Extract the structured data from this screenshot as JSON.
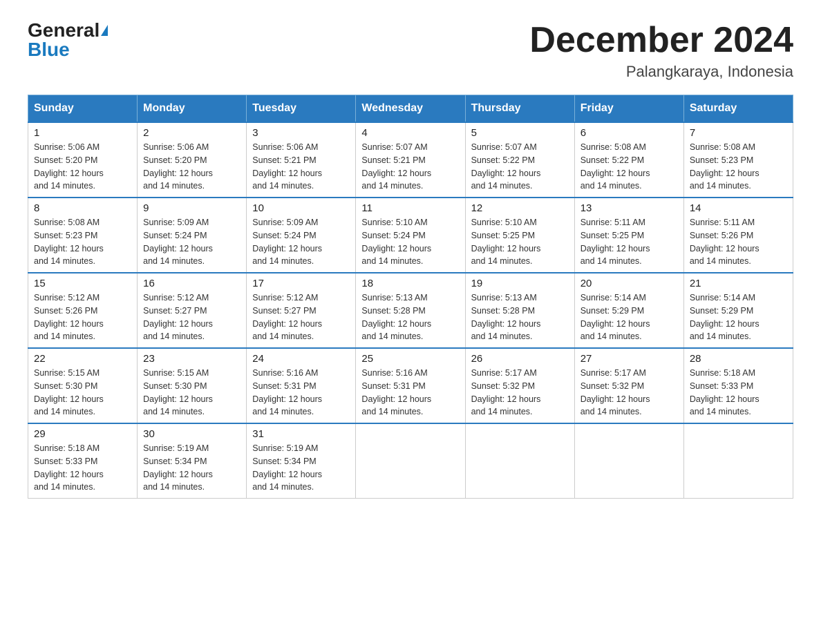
{
  "header": {
    "logo_general": "General",
    "logo_blue": "Blue",
    "month_title": "December 2024",
    "location": "Palangkaraya, Indonesia"
  },
  "days_of_week": [
    "Sunday",
    "Monday",
    "Tuesday",
    "Wednesday",
    "Thursday",
    "Friday",
    "Saturday"
  ],
  "weeks": [
    [
      {
        "day": "1",
        "sunrise": "5:06 AM",
        "sunset": "5:20 PM",
        "daylight": "12 hours and 14 minutes."
      },
      {
        "day": "2",
        "sunrise": "5:06 AM",
        "sunset": "5:20 PM",
        "daylight": "12 hours and 14 minutes."
      },
      {
        "day": "3",
        "sunrise": "5:06 AM",
        "sunset": "5:21 PM",
        "daylight": "12 hours and 14 minutes."
      },
      {
        "day": "4",
        "sunrise": "5:07 AM",
        "sunset": "5:21 PM",
        "daylight": "12 hours and 14 minutes."
      },
      {
        "day": "5",
        "sunrise": "5:07 AM",
        "sunset": "5:22 PM",
        "daylight": "12 hours and 14 minutes."
      },
      {
        "day": "6",
        "sunrise": "5:08 AM",
        "sunset": "5:22 PM",
        "daylight": "12 hours and 14 minutes."
      },
      {
        "day": "7",
        "sunrise": "5:08 AM",
        "sunset": "5:23 PM",
        "daylight": "12 hours and 14 minutes."
      }
    ],
    [
      {
        "day": "8",
        "sunrise": "5:08 AM",
        "sunset": "5:23 PM",
        "daylight": "12 hours and 14 minutes."
      },
      {
        "day": "9",
        "sunrise": "5:09 AM",
        "sunset": "5:24 PM",
        "daylight": "12 hours and 14 minutes."
      },
      {
        "day": "10",
        "sunrise": "5:09 AM",
        "sunset": "5:24 PM",
        "daylight": "12 hours and 14 minutes."
      },
      {
        "day": "11",
        "sunrise": "5:10 AM",
        "sunset": "5:24 PM",
        "daylight": "12 hours and 14 minutes."
      },
      {
        "day": "12",
        "sunrise": "5:10 AM",
        "sunset": "5:25 PM",
        "daylight": "12 hours and 14 minutes."
      },
      {
        "day": "13",
        "sunrise": "5:11 AM",
        "sunset": "5:25 PM",
        "daylight": "12 hours and 14 minutes."
      },
      {
        "day": "14",
        "sunrise": "5:11 AM",
        "sunset": "5:26 PM",
        "daylight": "12 hours and 14 minutes."
      }
    ],
    [
      {
        "day": "15",
        "sunrise": "5:12 AM",
        "sunset": "5:26 PM",
        "daylight": "12 hours and 14 minutes."
      },
      {
        "day": "16",
        "sunrise": "5:12 AM",
        "sunset": "5:27 PM",
        "daylight": "12 hours and 14 minutes."
      },
      {
        "day": "17",
        "sunrise": "5:12 AM",
        "sunset": "5:27 PM",
        "daylight": "12 hours and 14 minutes."
      },
      {
        "day": "18",
        "sunrise": "5:13 AM",
        "sunset": "5:28 PM",
        "daylight": "12 hours and 14 minutes."
      },
      {
        "day": "19",
        "sunrise": "5:13 AM",
        "sunset": "5:28 PM",
        "daylight": "12 hours and 14 minutes."
      },
      {
        "day": "20",
        "sunrise": "5:14 AM",
        "sunset": "5:29 PM",
        "daylight": "12 hours and 14 minutes."
      },
      {
        "day": "21",
        "sunrise": "5:14 AM",
        "sunset": "5:29 PM",
        "daylight": "12 hours and 14 minutes."
      }
    ],
    [
      {
        "day": "22",
        "sunrise": "5:15 AM",
        "sunset": "5:30 PM",
        "daylight": "12 hours and 14 minutes."
      },
      {
        "day": "23",
        "sunrise": "5:15 AM",
        "sunset": "5:30 PM",
        "daylight": "12 hours and 14 minutes."
      },
      {
        "day": "24",
        "sunrise": "5:16 AM",
        "sunset": "5:31 PM",
        "daylight": "12 hours and 14 minutes."
      },
      {
        "day": "25",
        "sunrise": "5:16 AM",
        "sunset": "5:31 PM",
        "daylight": "12 hours and 14 minutes."
      },
      {
        "day": "26",
        "sunrise": "5:17 AM",
        "sunset": "5:32 PM",
        "daylight": "12 hours and 14 minutes."
      },
      {
        "day": "27",
        "sunrise": "5:17 AM",
        "sunset": "5:32 PM",
        "daylight": "12 hours and 14 minutes."
      },
      {
        "day": "28",
        "sunrise": "5:18 AM",
        "sunset": "5:33 PM",
        "daylight": "12 hours and 14 minutes."
      }
    ],
    [
      {
        "day": "29",
        "sunrise": "5:18 AM",
        "sunset": "5:33 PM",
        "daylight": "12 hours and 14 minutes."
      },
      {
        "day": "30",
        "sunrise": "5:19 AM",
        "sunset": "5:34 PM",
        "daylight": "12 hours and 14 minutes."
      },
      {
        "day": "31",
        "sunrise": "5:19 AM",
        "sunset": "5:34 PM",
        "daylight": "12 hours and 14 minutes."
      },
      null,
      null,
      null,
      null
    ]
  ],
  "labels": {
    "sunrise_prefix": "Sunrise: ",
    "sunset_prefix": "Sunset: ",
    "daylight_prefix": "Daylight: "
  }
}
